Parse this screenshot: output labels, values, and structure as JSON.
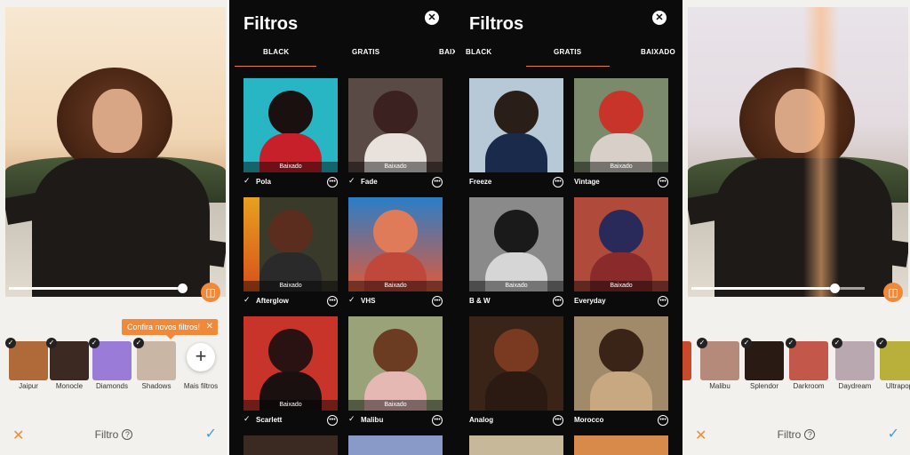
{
  "editor_left": {
    "slider_value": 0.8,
    "tooltip": "Confira novos filtros!",
    "tooltip_close": "✕",
    "filters": [
      {
        "label": "Jaipur",
        "color": "#b06a3a"
      },
      {
        "label": "Monocle",
        "color": "#3c2a22"
      },
      {
        "label": "Diamonds",
        "color": "#9a7bd8"
      },
      {
        "label": "Shadows",
        "color": "#c9b6a5"
      }
    ],
    "more_label": "Mais filtros",
    "more_icon": "+",
    "title": "Filtro",
    "info_icon": "?",
    "cancel_icon": "✕",
    "confirm_icon": "✓"
  },
  "sheet_black": {
    "title": "Filtros",
    "close_icon": "✕",
    "tabs": [
      "BLACK",
      "GRATIS",
      "BAIXADO"
    ],
    "active_tab": "BLACK",
    "cards": [
      {
        "label": "Pola",
        "badge": "Baixado",
        "bg": "#28b6c4",
        "fg": "#1a1010",
        "body": "#c8202a"
      },
      {
        "label": "Fade",
        "badge": "Baixado",
        "bg": "#5a4a46",
        "fg": "#3b2220",
        "body": "#e9e2dc"
      },
      {
        "label": "Afterglow",
        "badge": "Baixado",
        "bg": "#3a3a2a",
        "fg": "#5a2d1e",
        "body": "#2a2a2a"
      },
      {
        "label": "VHS",
        "badge": "Baixado",
        "bg": "#2a7ec8",
        "fg": "#e07b5a",
        "body": "#e05a3a"
      },
      {
        "label": "Scarlett",
        "badge": "Baixado",
        "bg": "#c8342a",
        "fg": "#2a1212",
        "body": "#1a1010"
      },
      {
        "label": "Malibu",
        "badge": "Baixado",
        "bg": "#9aa27a",
        "fg": "#6b3b22",
        "body": "#e6b8b4"
      }
    ]
  },
  "sheet_gratis": {
    "title": "Filtros",
    "close_icon": "✕",
    "tabs": [
      "BLACK",
      "GRATIS",
      "BAIXADO"
    ],
    "active_tab": "GRATIS",
    "cards": [
      {
        "label": "Freeze",
        "badge": "Baixado",
        "bg": "#b7c8d6",
        "fg": "#2a1e18",
        "body": "#1a2a4a"
      },
      {
        "label": "Vintage",
        "badge": "Baixado",
        "bg": "#7a8a6a",
        "fg": "#c8342a",
        "body": "#d8d0c8"
      },
      {
        "label": "B & W",
        "badge": "Baixado",
        "bg": "#8a8a8a",
        "fg": "#1a1a1a",
        "body": "#d6d6d6"
      },
      {
        "label": "Everyday",
        "badge": "Baixado",
        "bg": "#b04a3a",
        "fg": "#2a2a5a",
        "body": "#8a2a2a"
      },
      {
        "label": "Analog",
        "badge": "",
        "bg": "#3a2418",
        "fg": "#7a3a22",
        "body": "#2a1a12"
      },
      {
        "label": "Morocco",
        "badge": "",
        "bg": "#a08a6a",
        "fg": "#3a2418",
        "body": "#c8a880"
      }
    ]
  },
  "editor_right": {
    "slider_value": 0.8,
    "filters": [
      {
        "label": "Malibu",
        "color": "#b58a7a"
      },
      {
        "label": "Splendor",
        "color": "#2a1a14"
      },
      {
        "label": "Darkroom",
        "color": "#c2574a"
      },
      {
        "label": "Daydream",
        "color": "#b9a8b0"
      },
      {
        "label": "Ultrapop",
        "color": "#b8b03a"
      }
    ],
    "title": "Filtro",
    "info_icon": "?",
    "cancel_icon": "✕",
    "confirm_icon": "✓"
  }
}
